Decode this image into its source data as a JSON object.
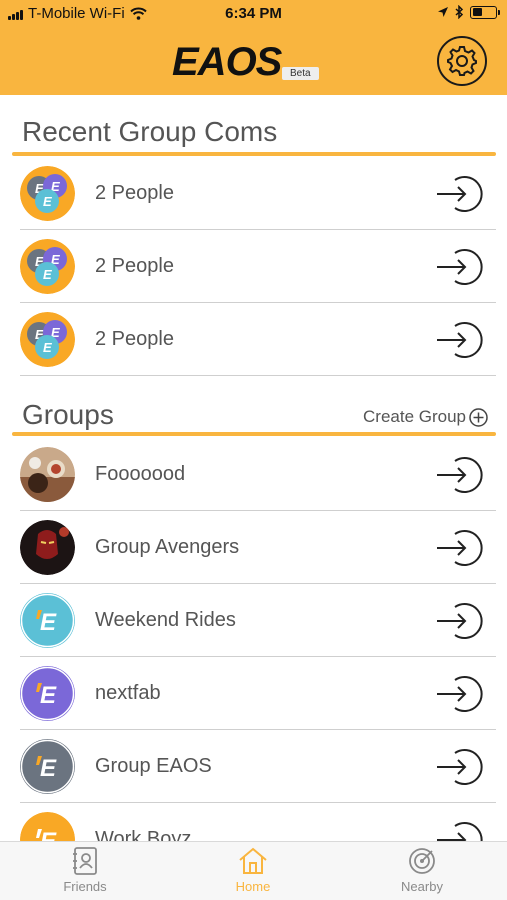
{
  "status_bar": {
    "carrier": "T-Mobile Wi-Fi",
    "time": "6:34 PM"
  },
  "header": {
    "logo_text": "EAOS",
    "beta_label": "Beta"
  },
  "recent": {
    "title": "Recent Group Coms",
    "items": [
      {
        "label": "2 People"
      },
      {
        "label": "2 People"
      },
      {
        "label": "2 People"
      }
    ]
  },
  "groups": {
    "title": "Groups",
    "create_label": "Create Group",
    "items": [
      {
        "label": "Fooooood"
      },
      {
        "label": "Group Avengers"
      },
      {
        "label": "Weekend Rides"
      },
      {
        "label": "nextfab"
      },
      {
        "label": "Group EAOS"
      },
      {
        "label": "Work Boyz"
      }
    ]
  },
  "tabs": [
    {
      "label": "Friends",
      "icon": "contacts-icon"
    },
    {
      "label": "Home",
      "icon": "home-icon"
    },
    {
      "label": "Nearby",
      "icon": "radar-icon"
    }
  ],
  "colors": {
    "accent": "#F9B53F",
    "avatar_teal": "#5BC0D6",
    "avatar_purple": "#7B68D8",
    "avatar_gray": "#6B7480",
    "avatar_orange": "#F9A825"
  }
}
